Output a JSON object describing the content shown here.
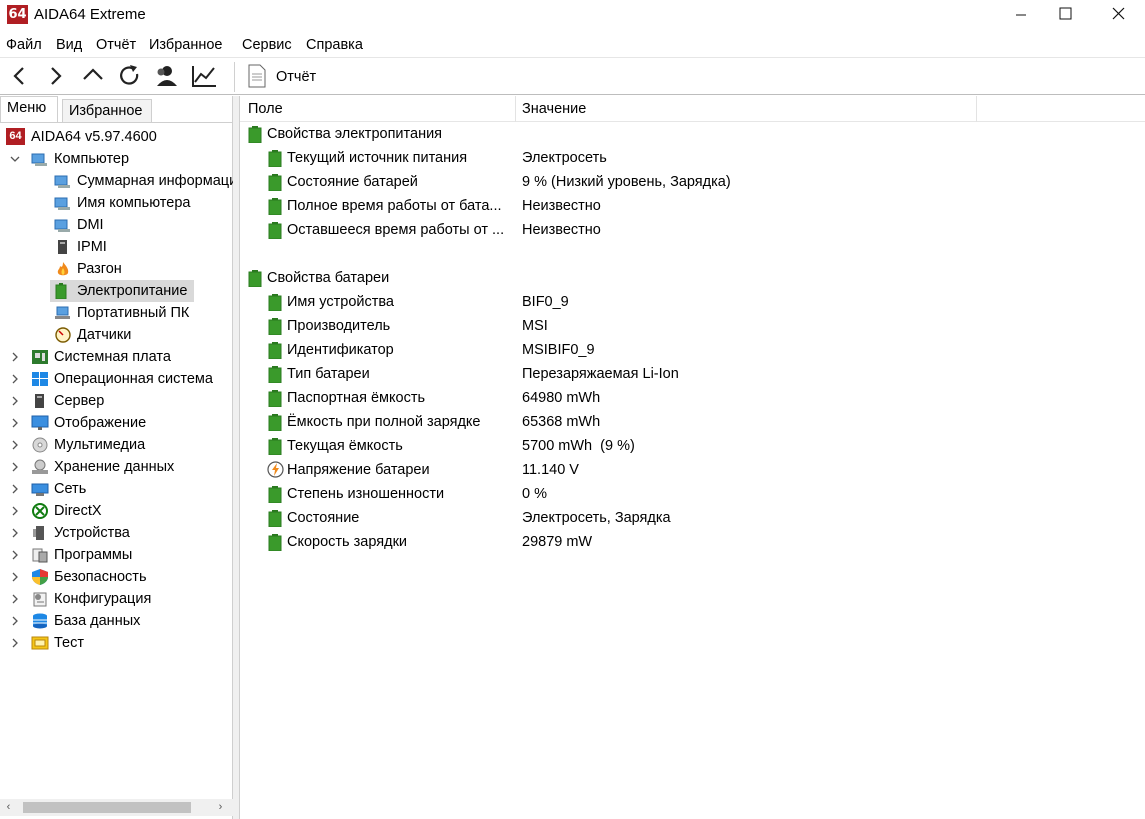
{
  "window": {
    "app_icon_text": "64",
    "title": "AIDA64 Extreme",
    "min_symbol": "—",
    "max_symbol": "☐",
    "close_symbol": "✕"
  },
  "menubar": [
    "Файл",
    "Вид",
    "Отчёт",
    "Избранное",
    "Сервис",
    "Справка"
  ],
  "toolbar": {
    "buttons": [
      "back-icon",
      "forward-icon",
      "up-icon",
      "refresh-icon",
      "user-icon",
      "chart-icon"
    ],
    "report_label": "Отчёт"
  },
  "tabs": {
    "menu": "Меню",
    "favorites": "Избранное"
  },
  "tree": {
    "root": "AIDA64 v5.97.4600",
    "computer": "Компьютер",
    "computer_children": [
      "Суммарная информация",
      "Имя компьютера",
      "DMI",
      "IPMI",
      "Разгон",
      "Электропитание",
      "Портативный ПК",
      "Датчики"
    ],
    "selected": "Электропитание",
    "top_items": [
      "Системная плата",
      "Операционная система",
      "Сервер",
      "Отображение",
      "Мультимедиа",
      "Хранение данных",
      "Сеть",
      "DirectX",
      "Устройства",
      "Программы",
      "Безопасность",
      "Конфигурация",
      "База данных",
      "Тест"
    ]
  },
  "list": {
    "col_field": "Поле",
    "col_value": "Значение",
    "sections": [
      {
        "title": "Свойства электропитания",
        "rows": [
          {
            "field": "Текущий источник питания",
            "value": "Электросеть"
          },
          {
            "field": "Состояние батарей",
            "value": "9 % (Низкий уровень, Зарядка)"
          },
          {
            "field": "Полное время работы от бата...",
            "value": "Неизвестно"
          },
          {
            "field": "Оставшееся время работы от ...",
            "value": "Неизвестно"
          }
        ]
      },
      {
        "title": "Свойства батареи",
        "rows": [
          {
            "field": "Имя устройства",
            "value": "BIF0_9"
          },
          {
            "field": "Производитель",
            "value": "MSI"
          },
          {
            "field": "Идентификатор",
            "value": "MSIBIF0_9"
          },
          {
            "field": "Тип батареи",
            "value": "Перезаряжаемая Li-Ion"
          },
          {
            "field": "Паспортная ёмкость",
            "value": "64980 mWh"
          },
          {
            "field": "Ёмкость при полной зарядке",
            "value": "65368 mWh"
          },
          {
            "field": "Текущая ёмкость",
            "value": "5700 mWh  (9 %)"
          },
          {
            "field": "Напряжение батареи",
            "value": "11.140 V"
          },
          {
            "field": "Степень изношенности",
            "value": "0 %"
          },
          {
            "field": "Состояние",
            "value": "Электросеть, Зарядка"
          },
          {
            "field": "Скорость зарядки",
            "value": "29879 mW"
          }
        ]
      }
    ]
  },
  "colors": {
    "brand_red": "#b01e23",
    "battery_green": "#3a9a2b",
    "selection": "#d9d9d9"
  }
}
